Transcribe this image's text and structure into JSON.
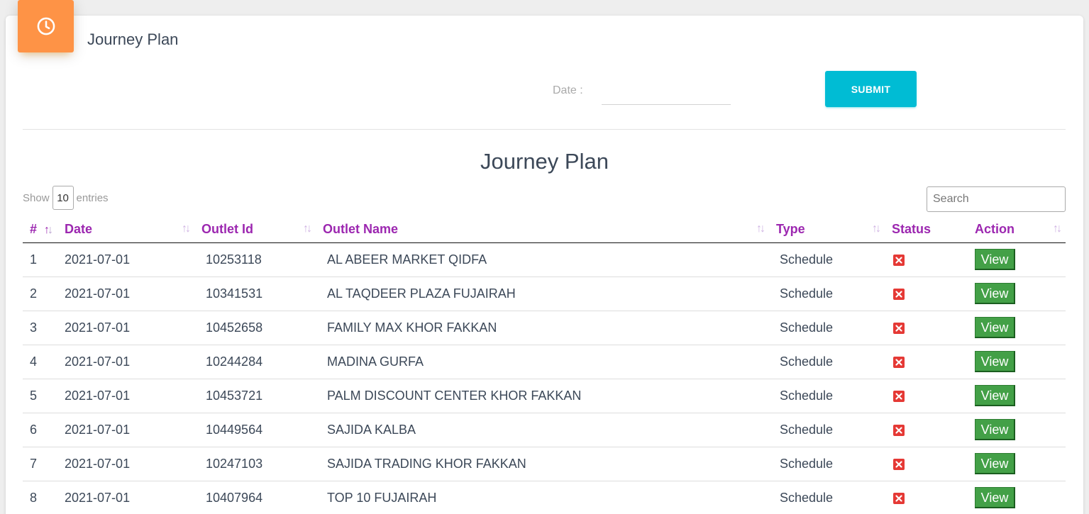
{
  "header": {
    "title": "Journey Plan",
    "icon": "clock-icon",
    "icon_color": "#fe9346"
  },
  "filter": {
    "date_label": "Date :",
    "date_value": "",
    "submit_label": "SUBMIT",
    "submit_color": "#00bcd4"
  },
  "table_section": {
    "title": "Journey Plan",
    "show_label": "Show",
    "entries_value": "10",
    "entries_label": "entries",
    "search_placeholder": "Search"
  },
  "columns": [
    "#",
    "Date",
    "Outlet Id",
    "Outlet Name",
    "Type",
    "Status",
    "Action"
  ],
  "header_color": "#9c27b0",
  "rows": [
    {
      "num": "1",
      "date": "2021-07-01",
      "outlet_id": "10253118",
      "outlet_name": "AL ABEER MARKET QIDFA",
      "type": "Schedule",
      "status": "not-visited",
      "action": "View"
    },
    {
      "num": "2",
      "date": "2021-07-01",
      "outlet_id": "10341531",
      "outlet_name": "AL TAQDEER PLAZA FUJAIRAH",
      "type": "Schedule",
      "status": "not-visited",
      "action": "View"
    },
    {
      "num": "3",
      "date": "2021-07-01",
      "outlet_id": "10452658",
      "outlet_name": "FAMILY MAX KHOR FAKKAN",
      "type": "Schedule",
      "status": "not-visited",
      "action": "View"
    },
    {
      "num": "4",
      "date": "2021-07-01",
      "outlet_id": "10244284",
      "outlet_name": "MADINA GURFA",
      "type": "Schedule",
      "status": "not-visited",
      "action": "View"
    },
    {
      "num": "5",
      "date": "2021-07-01",
      "outlet_id": "10453721",
      "outlet_name": "PALM DISCOUNT CENTER KHOR FAKKAN",
      "type": "Schedule",
      "status": "not-visited",
      "action": "View"
    },
    {
      "num": "6",
      "date": "2021-07-01",
      "outlet_id": "10449564",
      "outlet_name": "SAJIDA KALBA",
      "type": "Schedule",
      "status": "not-visited",
      "action": "View"
    },
    {
      "num": "7",
      "date": "2021-07-01",
      "outlet_id": "10247103",
      "outlet_name": "SAJIDA TRADING KHOR FAKKAN",
      "type": "Schedule",
      "status": "not-visited",
      "action": "View"
    },
    {
      "num": "8",
      "date": "2021-07-01",
      "outlet_id": "10407964",
      "outlet_name": "TOP 10 FUJAIRAH",
      "type": "Schedule",
      "status": "not-visited",
      "action": "View"
    }
  ]
}
